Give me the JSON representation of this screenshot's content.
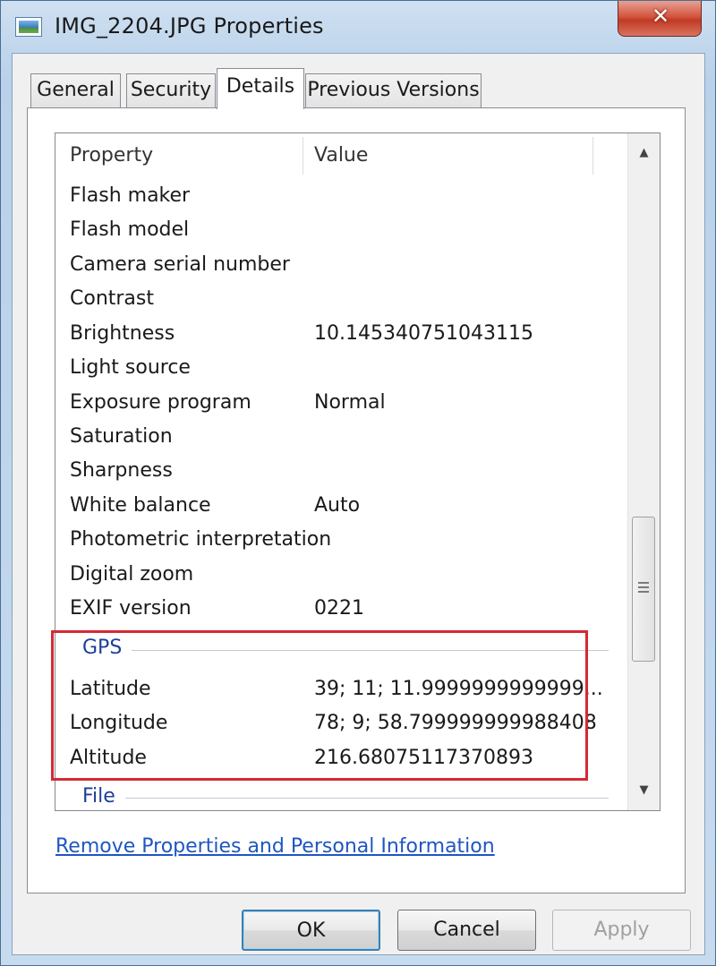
{
  "window": {
    "title": "IMG_2204.JPG Properties",
    "close_glyph": "✕"
  },
  "tabs": [
    {
      "label": "General",
      "active": false
    },
    {
      "label": "Security",
      "active": false
    },
    {
      "label": "Details",
      "active": true
    },
    {
      "label": "Previous Versions",
      "active": false
    }
  ],
  "list": {
    "headers": {
      "property": "Property",
      "value": "Value"
    },
    "rows": [
      {
        "name": "Flash maker",
        "value": ""
      },
      {
        "name": "Flash model",
        "value": ""
      },
      {
        "name": "Camera serial number",
        "value": ""
      },
      {
        "name": "Contrast",
        "value": ""
      },
      {
        "name": "Brightness",
        "value": "10.145340751043115"
      },
      {
        "name": "Light source",
        "value": ""
      },
      {
        "name": "Exposure program",
        "value": "Normal"
      },
      {
        "name": "Saturation",
        "value": ""
      },
      {
        "name": "Sharpness",
        "value": ""
      },
      {
        "name": "White balance",
        "value": "Auto"
      },
      {
        "name": "Photometric interpretation",
        "value": ""
      },
      {
        "name": "Digital zoom",
        "value": ""
      },
      {
        "name": "EXIF version",
        "value": "0221"
      }
    ],
    "gps_group": {
      "label": "GPS",
      "rows": [
        {
          "name": "Latitude",
          "value": "39; 11; 11.9999999999999..."
        },
        {
          "name": "Longitude",
          "value": "78; 9; 58.799999999988408"
        },
        {
          "name": "Altitude",
          "value": "216.68075117370893"
        }
      ]
    },
    "file_group": {
      "label": "File"
    }
  },
  "scrollbar": {
    "up_glyph": "▲",
    "down_glyph": "▼"
  },
  "remove_link": "Remove Properties and Personal Information",
  "buttons": {
    "ok": "OK",
    "cancel": "Cancel",
    "apply": "Apply"
  },
  "colors": {
    "highlight": "#d42a34",
    "group_label": "#1e3f9a",
    "link": "#1f56c1"
  }
}
